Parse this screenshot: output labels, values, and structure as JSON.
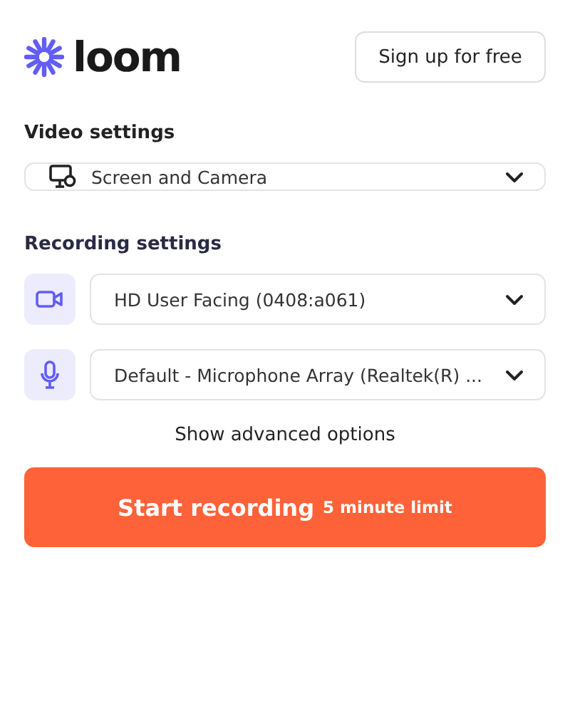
{
  "header": {
    "logo": "loom",
    "signup_button": "Sign up for free"
  },
  "video_settings": {
    "heading": "Video settings",
    "select": {
      "kind": "screen-camera",
      "value": "Screen and Camera"
    }
  },
  "recording_settings": {
    "heading": "Recording settings",
    "devices": [
      {
        "kind": "camera",
        "value": "HD User Facing (0408:a061)"
      },
      {
        "kind": "microphone",
        "value": "Default - Microphone Array (Realtek(R) ..."
      }
    ]
  },
  "advanced_link": "Show advanced options",
  "start_button": {
    "label": "Start recording",
    "note": "5 minute limit"
  }
}
